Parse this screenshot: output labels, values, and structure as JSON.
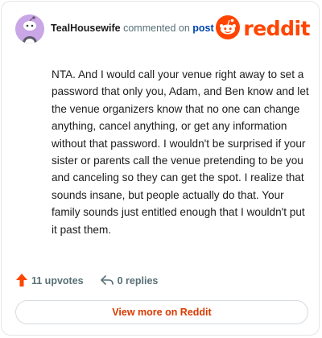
{
  "header": {
    "username": "TealHousewife",
    "action_text": "commented on",
    "post_link": "post",
    "brand_name": "reddit"
  },
  "comment": {
    "text": "NTA. And I would call your venue right away to set a password that only you, Adam, and Ben know and let the venue organizers know that no one can change anything, cancel anything, or get any information without that password. I wouldn't be surprised if your sister or parents call the venue pretending to be you and canceling so they can get the spot. I realize that sounds insane, but people actually do that. Your family sounds just entitled enough that I wouldn't put it past them."
  },
  "footer": {
    "upvotes_label": "11 upvotes",
    "replies_label": "0 replies"
  },
  "view_more": {
    "label": "View more on Reddit"
  },
  "colors": {
    "brand": "#ff4500",
    "upvote": "#ff4500",
    "avatar_bg": "#c9a6e6",
    "link": "#0045ac",
    "view_more_text": "#d93a00"
  },
  "icons": {
    "avatar": "snoo-avatar-icon",
    "brand": "reddit-logo-icon",
    "upvote": "upvote-arrow-icon",
    "reply": "reply-arrow-icon"
  }
}
